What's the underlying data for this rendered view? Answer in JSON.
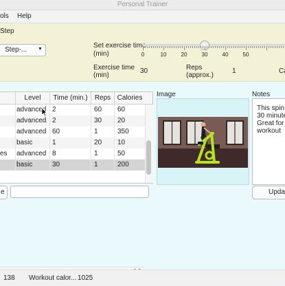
{
  "window": {
    "title": "Personal Trainer"
  },
  "menu": {
    "items": [
      "ols",
      "Help"
    ]
  },
  "controls": {
    "step_heading": "Step",
    "step_dropdown": "Step-...",
    "set_time_label_1": "Set exercise time",
    "set_time_label_2": "(min)",
    "slider_ticks": [
      "0",
      "10",
      "20",
      "30",
      "40",
      "50"
    ],
    "slider_value": 30,
    "exercise_time_label_1": "Exercise time",
    "exercise_time_label_2": "(min)",
    "exercise_time_value": "30",
    "reps_label_1": "Reps",
    "reps_label_2": "(approx.)",
    "reps_value": "1",
    "calories_label_cut": "Ca"
  },
  "table": {
    "columns": [
      "Level",
      "Time (min.)",
      "Reps",
      "Calories"
    ],
    "rows": [
      {
        "first": "",
        "level": "advanced",
        "time": "2",
        "reps": "60",
        "calories": "60"
      },
      {
        "first": "",
        "level": "advanced",
        "time": "2",
        "reps": "30",
        "calories": "20"
      },
      {
        "first": "",
        "level": "advanced",
        "time": "60",
        "reps": "1",
        "calories": "350"
      },
      {
        "first": "",
        "level": "basic",
        "time": "1",
        "reps": "20",
        "calories": "10"
      },
      {
        "first": "es",
        "level": "advanced",
        "time": "8",
        "reps": "1",
        "calories": "50"
      },
      {
        "first": "",
        "level": "basic",
        "time": "30",
        "reps": "1",
        "calories": "200"
      }
    ],
    "selected_row": 5
  },
  "search": {
    "button_label": "e",
    "value": ""
  },
  "image_panel": {
    "label": "Image"
  },
  "notes_panel": {
    "label": "Notes",
    "lines": [
      "This spin m",
      "30 minute",
      "Great for c",
      "workout"
    ],
    "update_button": "Upda"
  },
  "status": {
    "count": "138",
    "workout_calories_label": "Workout calor...",
    "workout_calories_value": "1025"
  },
  "colors": {
    "top_panel": "#f3f2d6",
    "background": "#eafafc",
    "bike": "#b8e21c"
  }
}
